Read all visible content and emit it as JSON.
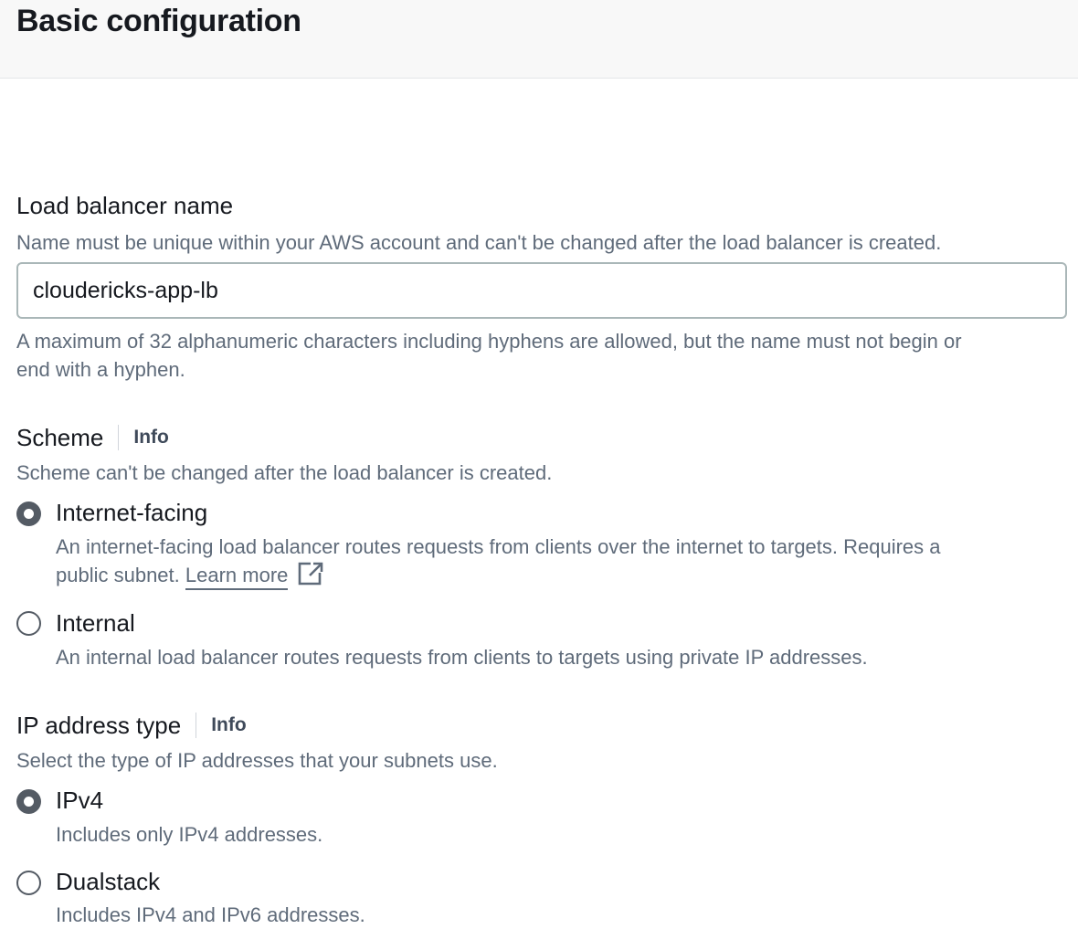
{
  "header": {
    "title": "Basic configuration"
  },
  "load_balancer_name": {
    "label": "Load balancer name",
    "description": "Name must be unique within your AWS account and can't be changed after the load balancer is created.",
    "value": "cloudericks-app-lb",
    "constraint": "A maximum of 32 alphanumeric characters including hyphens are allowed, but the name must not begin or",
    "constraint_line2": "end with a hyphen."
  },
  "scheme": {
    "label": "Scheme",
    "info": "Info",
    "description": "Scheme can't be changed after the load balancer is created.",
    "options": [
      {
        "label": "Internet-facing",
        "selected": true,
        "description": "An internet-facing load balancer routes requests from clients over the internet to targets. Requires a",
        "description_line2": "public subnet.",
        "link": "Learn more"
      },
      {
        "label": "Internal",
        "selected": false,
        "description": "An internal load balancer routes requests from clients to targets using private IP addresses."
      }
    ]
  },
  "ip_address_type": {
    "label": "IP address type",
    "info": "Info",
    "description": "Select the type of IP addresses that your subnets use.",
    "options": [
      {
        "label": "IPv4",
        "selected": true,
        "description": "Includes only IPv4 addresses."
      },
      {
        "label": "Dualstack",
        "selected": false,
        "description": "Includes IPv4 and IPv6 addresses."
      }
    ]
  },
  "icons": {
    "external_link": "external-link-icon"
  },
  "colors": {
    "text": "#16191f",
    "secondary_text": "#5f6b7a",
    "radio": "#545b64",
    "border": "#aab7b8"
  }
}
